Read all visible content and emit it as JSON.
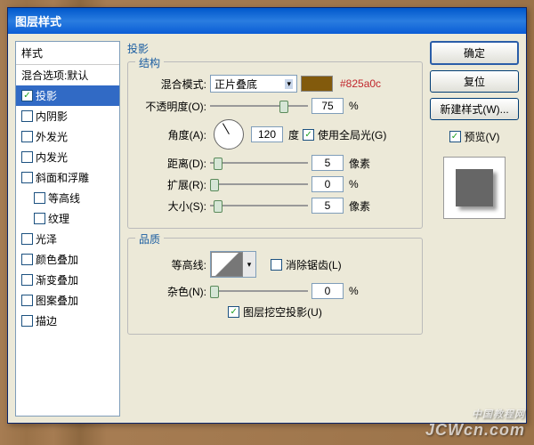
{
  "dialog": {
    "title": "图层样式"
  },
  "styles": {
    "header": "样式",
    "blending_options": "混合选项:默认",
    "items": [
      {
        "label": "投影",
        "checked": true,
        "selected": true
      },
      {
        "label": "内阴影",
        "checked": false
      },
      {
        "label": "外发光",
        "checked": false
      },
      {
        "label": "内发光",
        "checked": false
      },
      {
        "label": "斜面和浮雕",
        "checked": false
      },
      {
        "label": "等高线",
        "checked": false,
        "sub": true
      },
      {
        "label": "纹理",
        "checked": false,
        "sub": true
      },
      {
        "label": "光泽",
        "checked": false
      },
      {
        "label": "颜色叠加",
        "checked": false
      },
      {
        "label": "渐变叠加",
        "checked": false
      },
      {
        "label": "图案叠加",
        "checked": false
      },
      {
        "label": "描边",
        "checked": false
      }
    ]
  },
  "panel": {
    "title": "投影",
    "structure": {
      "legend": "结构",
      "blend_mode_label": "混合模式:",
      "blend_mode_value": "正片叠底",
      "color_annotation": "#825a0c",
      "opacity_label": "不透明度(O):",
      "opacity_value": "75",
      "opacity_unit": "%",
      "angle_label": "角度(A):",
      "angle_value": "120",
      "angle_unit": "度",
      "global_light_label": "使用全局光(G)",
      "global_light_checked": true,
      "distance_label": "距离(D):",
      "distance_value": "5",
      "distance_unit": "像素",
      "spread_label": "扩展(R):",
      "spread_value": "0",
      "spread_unit": "%",
      "size_label": "大小(S):",
      "size_value": "5",
      "size_unit": "像素"
    },
    "quality": {
      "legend": "品质",
      "contour_label": "等高线:",
      "anti_alias_label": "消除锯齿(L)",
      "anti_alias_checked": false,
      "noise_label": "杂色(N):",
      "noise_value": "0",
      "noise_unit": "%",
      "knockout_label": "图层挖空投影(U)",
      "knockout_checked": true
    }
  },
  "buttons": {
    "ok": "确定",
    "cancel": "复位",
    "new_style": "新建样式(W)...",
    "preview": "预览(V)"
  },
  "watermark": {
    "cn": "中国教程网",
    "en": "JCWcn.com"
  }
}
